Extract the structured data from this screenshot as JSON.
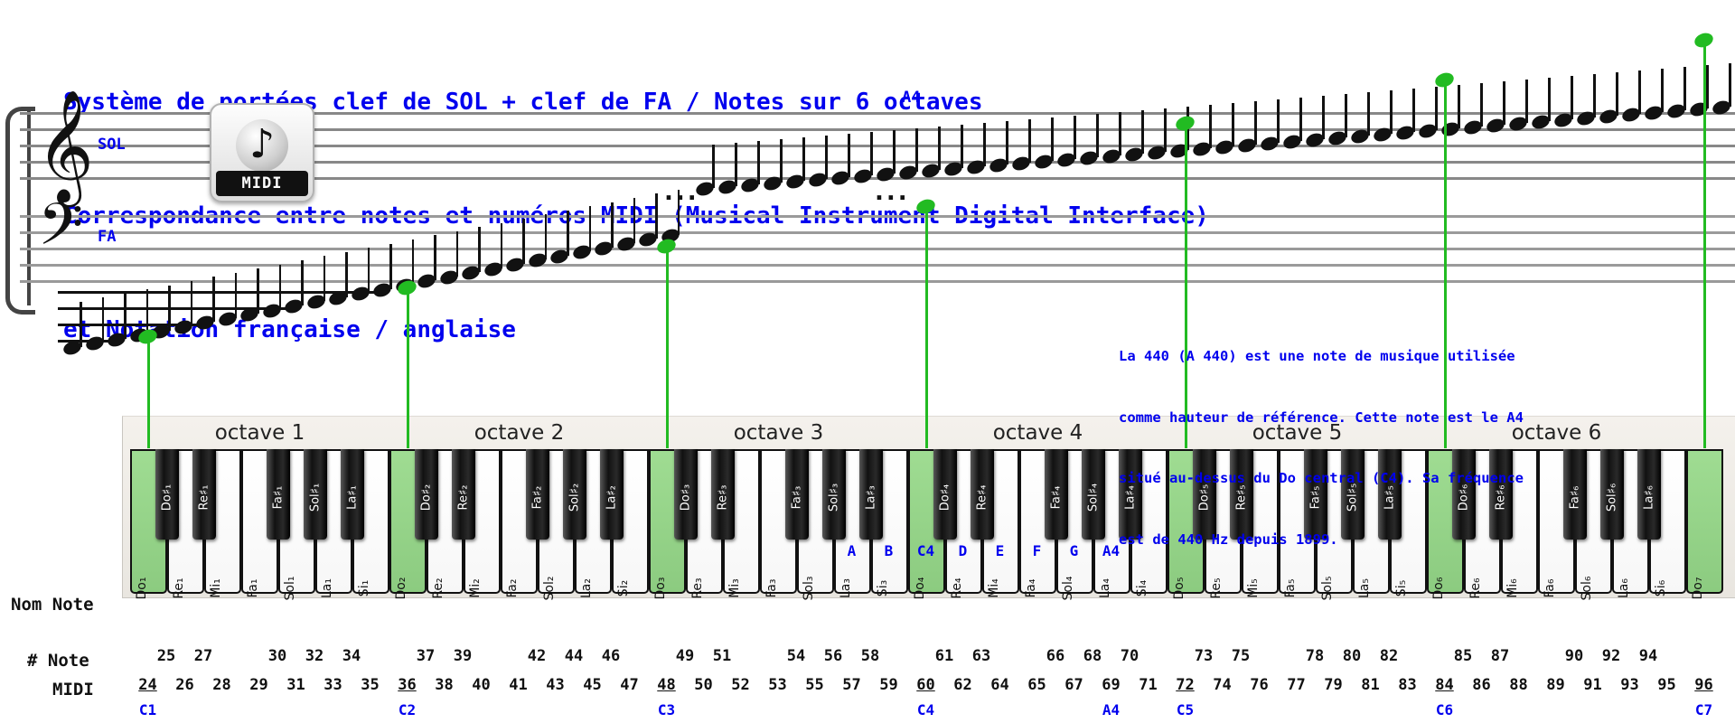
{
  "title": {
    "line1": "Système de portées clef de SOL + clef de FA / Notes sur 6 octaves",
    "line2": "Correspondance entre notes et numéros MIDI (Musical Instrument Digital Interface)",
    "line3": "et Notation française / anglaise",
    "color": "#0000ee"
  },
  "staff": {
    "treble_label": "SOL",
    "bass_label": "FA",
    "treble_clef_glyph": "𝄞",
    "bass_clef_glyph": "𝄢",
    "a4_marker": "A4",
    "ellipsis_left": "...",
    "ellipsis_right": "..."
  },
  "logo": {
    "glyph": "♪",
    "text": "MIDI"
  },
  "note440": {
    "line1": "La 440 (A 440) est une note de musique utilisée",
    "line2": "comme hauteur de référence. Cette note est le A4",
    "line3": "situé au-dessus du Do central (C4). Sa fréquence",
    "line4": "est de 440 Hz depuis 1899."
  },
  "keyboard": {
    "octave_bands": [
      "octave 1",
      "octave 2",
      "octave 3",
      "octave 4",
      "octave 5",
      "octave 6"
    ],
    "white_keys": [
      {
        "label": "Do₁",
        "green": true
      },
      {
        "label": "Re₁",
        "green": false
      },
      {
        "label": "Mi₁",
        "green": false
      },
      {
        "label": "Fa₁",
        "green": false
      },
      {
        "label": "Sol₁",
        "green": false
      },
      {
        "label": "La₁",
        "green": false
      },
      {
        "label": "Si₁",
        "green": false
      },
      {
        "label": "Do₂",
        "green": true
      },
      {
        "label": "Re₂",
        "green": false
      },
      {
        "label": "Mi₂",
        "green": false
      },
      {
        "label": "Fa₂",
        "green": false
      },
      {
        "label": "Sol₂",
        "green": false
      },
      {
        "label": "La₂",
        "green": false
      },
      {
        "label": "Si₂",
        "green": false
      },
      {
        "label": "Do₃",
        "green": true
      },
      {
        "label": "Re₃",
        "green": false
      },
      {
        "label": "Mi₃",
        "green": false
      },
      {
        "label": "Fa₃",
        "green": false
      },
      {
        "label": "Sol₃",
        "green": false
      },
      {
        "label": "La₃",
        "green": false
      },
      {
        "label": "Si₃",
        "green": false
      },
      {
        "label": "Do₄",
        "green": true
      },
      {
        "label": "Re₄",
        "green": false
      },
      {
        "label": "Mi₄",
        "green": false
      },
      {
        "label": "Fa₄",
        "green": false
      },
      {
        "label": "Sol₄",
        "green": false
      },
      {
        "label": "La₄",
        "green": false
      },
      {
        "label": "Si₄",
        "green": false
      },
      {
        "label": "Do₅",
        "green": true
      },
      {
        "label": "Re₅",
        "green": false
      },
      {
        "label": "Mi₅",
        "green": false
      },
      {
        "label": "Fa₅",
        "green": false
      },
      {
        "label": "Sol₅",
        "green": false
      },
      {
        "label": "La₅",
        "green": false
      },
      {
        "label": "Si₅",
        "green": false
      },
      {
        "label": "Do₆",
        "green": true
      },
      {
        "label": "Re₆",
        "green": false
      },
      {
        "label": "Mi₆",
        "green": false
      },
      {
        "label": "Fa₆",
        "green": false
      },
      {
        "label": "Sol₆",
        "green": false
      },
      {
        "label": "La₆",
        "green": false
      },
      {
        "label": "Si₆",
        "green": false
      },
      {
        "label": "Do₇",
        "green": true
      }
    ],
    "black_keys": [
      {
        "label": "Do♯₁",
        "after": 0
      },
      {
        "label": "Re♯₁",
        "after": 1
      },
      {
        "label": "Fa♯₁",
        "after": 3
      },
      {
        "label": "Sol♯₁",
        "after": 4
      },
      {
        "label": "La♯₁",
        "after": 5
      },
      {
        "label": "Do♯₂",
        "after": 7
      },
      {
        "label": "Re♯₂",
        "after": 8
      },
      {
        "label": "Fa♯₂",
        "after": 10
      },
      {
        "label": "Sol♯₂",
        "after": 11
      },
      {
        "label": "La♯₂",
        "after": 12
      },
      {
        "label": "Do♯₃",
        "after": 14
      },
      {
        "label": "Re♯₃",
        "after": 15
      },
      {
        "label": "Fa♯₃",
        "after": 17
      },
      {
        "label": "Sol♯₃",
        "after": 18
      },
      {
        "label": "La♯₃",
        "after": 19
      },
      {
        "label": "Do♯₄",
        "after": 21
      },
      {
        "label": "Re♯₄",
        "after": 22
      },
      {
        "label": "Fa♯₄",
        "after": 24
      },
      {
        "label": "Sol♯₄",
        "after": 25
      },
      {
        "label": "La♯₄",
        "after": 26
      },
      {
        "label": "Do♯₅",
        "after": 28
      },
      {
        "label": "Re♯₅",
        "after": 29
      },
      {
        "label": "Fa♯₅",
        "after": 31
      },
      {
        "label": "Sol♯₅",
        "after": 32
      },
      {
        "label": "La♯₅",
        "after": 33
      },
      {
        "label": "Do♯₆",
        "after": 35
      },
      {
        "label": "Re♯₆",
        "after": 36
      },
      {
        "label": "Fa♯₆",
        "after": 38
      },
      {
        "label": "Sol♯₆",
        "after": 39
      },
      {
        "label": "La♯₆",
        "after": 40
      }
    ],
    "english_labels": [
      {
        "text": "A",
        "white_index": 19
      },
      {
        "text": "B",
        "white_index": 20
      },
      {
        "text": "C4",
        "white_index": 21
      },
      {
        "text": "D",
        "white_index": 22
      },
      {
        "text": "E",
        "white_index": 23
      },
      {
        "text": "F",
        "white_index": 24
      },
      {
        "text": "G",
        "white_index": 25
      },
      {
        "text": "A4",
        "white_index": 26
      }
    ]
  },
  "rows": {
    "nom_note_label": "Nom Note",
    "sharp_note_label": "# Note",
    "midi_label": "MIDI",
    "midi_white": [
      {
        "n": "24",
        "underline": true
      },
      {
        "n": "26"
      },
      {
        "n": "28"
      },
      {
        "n": "29"
      },
      {
        "n": "31"
      },
      {
        "n": "33"
      },
      {
        "n": "35"
      },
      {
        "n": "36",
        "underline": true
      },
      {
        "n": "38"
      },
      {
        "n": "40"
      },
      {
        "n": "41"
      },
      {
        "n": "43"
      },
      {
        "n": "45"
      },
      {
        "n": "47"
      },
      {
        "n": "48",
        "underline": true
      },
      {
        "n": "50"
      },
      {
        "n": "52"
      },
      {
        "n": "53"
      },
      {
        "n": "55"
      },
      {
        "n": "57"
      },
      {
        "n": "59"
      },
      {
        "n": "60",
        "underline": true
      },
      {
        "n": "62"
      },
      {
        "n": "64"
      },
      {
        "n": "65"
      },
      {
        "n": "67"
      },
      {
        "n": "69"
      },
      {
        "n": "71"
      },
      {
        "n": "72",
        "underline": true
      },
      {
        "n": "74"
      },
      {
        "n": "76"
      },
      {
        "n": "77"
      },
      {
        "n": "79"
      },
      {
        "n": "81"
      },
      {
        "n": "83"
      },
      {
        "n": "84",
        "underline": true
      },
      {
        "n": "86"
      },
      {
        "n": "88"
      },
      {
        "n": "89"
      },
      {
        "n": "91"
      },
      {
        "n": "93"
      },
      {
        "n": "95"
      },
      {
        "n": "96",
        "underline": true
      }
    ],
    "midi_black": [
      {
        "n": "25",
        "after": 0
      },
      {
        "n": "27",
        "after": 1
      },
      {
        "n": "30",
        "after": 3
      },
      {
        "n": "32",
        "after": 4
      },
      {
        "n": "34",
        "after": 5
      },
      {
        "n": "37",
        "after": 7
      },
      {
        "n": "39",
        "after": 8
      },
      {
        "n": "42",
        "after": 10
      },
      {
        "n": "44",
        "after": 11
      },
      {
        "n": "46",
        "after": 12
      },
      {
        "n": "49",
        "after": 14
      },
      {
        "n": "51",
        "after": 15
      },
      {
        "n": "54",
        "after": 17
      },
      {
        "n": "56",
        "after": 18
      },
      {
        "n": "58",
        "after": 19
      },
      {
        "n": "61",
        "after": 21
      },
      {
        "n": "63",
        "after": 22
      },
      {
        "n": "66",
        "after": 24
      },
      {
        "n": "68",
        "after": 25
      },
      {
        "n": "70",
        "after": 26
      },
      {
        "n": "73",
        "after": 28
      },
      {
        "n": "75",
        "after": 29
      },
      {
        "n": "78",
        "after": 31
      },
      {
        "n": "80",
        "after": 32
      },
      {
        "n": "82",
        "after": 33
      },
      {
        "n": "85",
        "after": 35
      },
      {
        "n": "87",
        "after": 36
      },
      {
        "n": "90",
        "after": 38
      },
      {
        "n": "92",
        "after": 39
      },
      {
        "n": "94",
        "after": 40
      }
    ],
    "c_markers": [
      {
        "text": "C1",
        "white_index": 0
      },
      {
        "text": "C2",
        "white_index": 7
      },
      {
        "text": "C3",
        "white_index": 14
      },
      {
        "text": "C4",
        "white_index": 21
      },
      {
        "text": "A4",
        "white_index": 26
      },
      {
        "text": "C5",
        "white_index": 28
      },
      {
        "text": "C6",
        "white_index": 35
      },
      {
        "text": "C7",
        "white_index": 42
      }
    ]
  },
  "colors": {
    "blue": "#0000ee",
    "green": "#22bb22",
    "key_green": "#8ccb80",
    "black": "#111111"
  }
}
